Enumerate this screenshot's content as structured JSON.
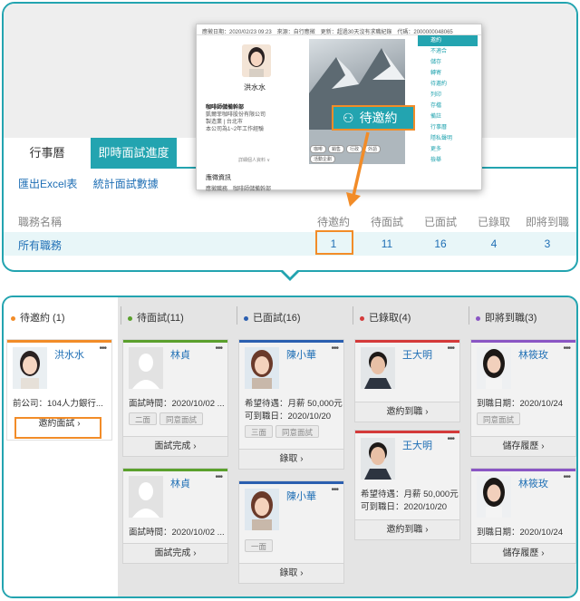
{
  "top": {
    "tabs": [
      "行事曆",
      "即時面試進度"
    ],
    "links": [
      "匯出Excel表",
      "統計面試數據"
    ],
    "table": {
      "headers": [
        "職務名稱",
        "待邀約",
        "待面試",
        "已面試",
        "已錄取",
        "即將到職"
      ],
      "row": [
        "所有職務",
        "1",
        "11",
        "16",
        "4",
        "3"
      ]
    },
    "callout": "待邀約",
    "preview": {
      "bar": "應徵日期：2020/02/23 09:23　來源：自行應徵　更新：超過30天沒有求職紀錄　代碼：2000000048065",
      "name": "洪水水",
      "info": [
        "咖啡師儲備幹部",
        "凱爾菲咖啡股份有限公司",
        "製造業 | 台北市",
        "本公司為1~2年工作經驗"
      ],
      "more": "詳細個人資料 ∨",
      "tags": [
        "咖啡",
        "銷售",
        "行政",
        "外語",
        "活動企劃"
      ],
      "section": "應徵資訊",
      "section_item": "應徵職務　咖啡師儲備幹部",
      "menu": [
        "邀約",
        "不適合",
        "儲存",
        "轉寄",
        "待邀約",
        "列印",
        "存檔",
        "備註",
        "行事曆",
        "隱私聲明",
        "更多",
        "檢舉"
      ]
    }
  },
  "columns": [
    {
      "title": "待邀約 (1)",
      "color": "#f28c28"
    },
    {
      "title": "待面試(11)",
      "color": "#5aa02c"
    },
    {
      "title": "已面試(16)",
      "color": "#2b5fb0"
    },
    {
      "title": "已錄取(4)",
      "color": "#d43a3a"
    },
    {
      "title": "即將到職(3)",
      "color": "#8a56c4"
    }
  ],
  "cards": {
    "c1": {
      "name": "洪水水",
      "line1": "前公司：104人力銀行...",
      "action": "邀約面試"
    },
    "c2a": {
      "name": "林貞",
      "line1": "面試時間：2020/10/02 ...",
      "chips": [
        "二面",
        "同意面試"
      ],
      "action": "面試完成"
    },
    "c2b": {
      "name": "林貞",
      "line1": "面試時間：2020/10/02 ...",
      "action": "面試完成"
    },
    "c3a": {
      "name": "陳小華",
      "line1": "希望待遇：月薪 50,000元",
      "line2": "可到職日：2020/10/20",
      "chips": [
        "三面",
        "同意面試"
      ],
      "action": "錄取"
    },
    "c3b": {
      "name": "陳小華",
      "chips": [
        "一面"
      ],
      "action": "錄取"
    },
    "c4a": {
      "name": "王大明",
      "action": "邀約到職"
    },
    "c4b": {
      "name": "王大明",
      "line1": "希望待遇：月薪 50,000元",
      "line2": "可到職日：2020/10/20",
      "action": "邀約到職"
    },
    "c5a": {
      "name": "林筱玫",
      "line1": "到職日期：2020/10/24",
      "chips": [
        "同意面試"
      ],
      "action": "儲存履歷"
    },
    "c5b": {
      "name": "林筱玫",
      "line1": "到職日期：2020/10/24",
      "action": "儲存履歷"
    }
  }
}
